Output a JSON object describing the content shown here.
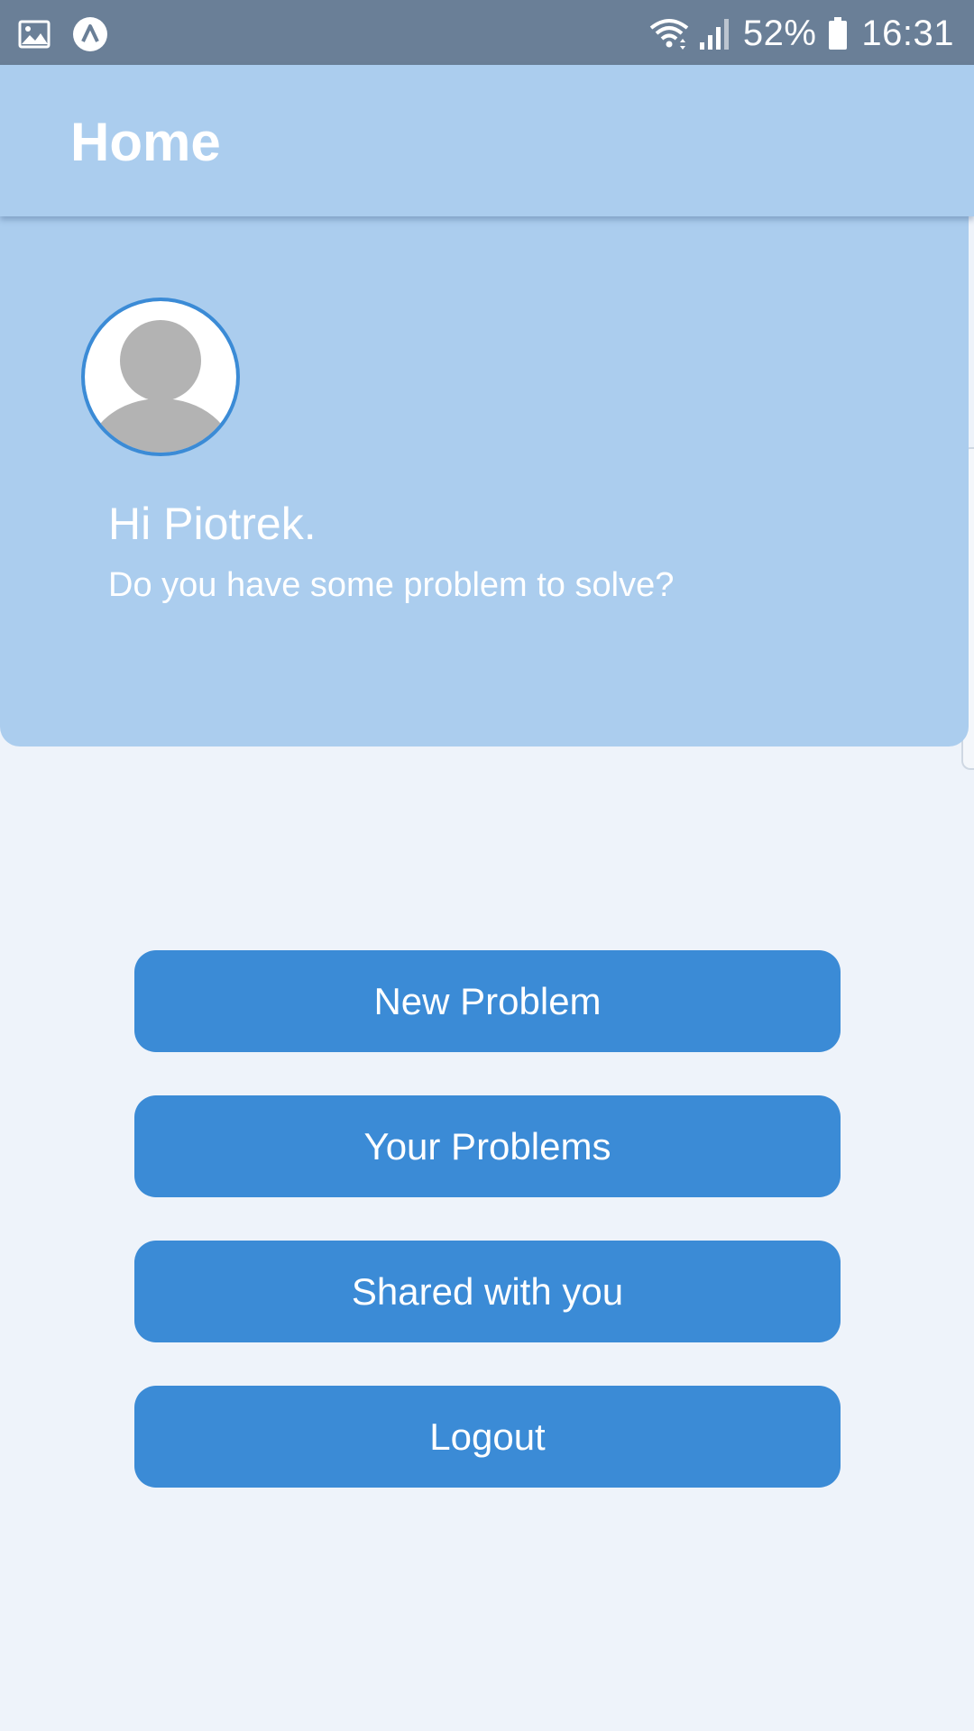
{
  "status_bar": {
    "left_icons": [
      "gallery-icon",
      "app-notification-icon"
    ],
    "right_icons": [
      "wifi-icon",
      "signal-icon",
      "battery-icon"
    ],
    "battery_percent": "52%",
    "time": "16:31"
  },
  "app_bar": {
    "title": "Home"
  },
  "profile": {
    "avatar_icon": "avatar-placeholder-icon",
    "greeting": "Hi Piotrek.",
    "subtitle": "Do you have some problem to solve?"
  },
  "actions": {
    "new_problem": "New Problem",
    "your_problems": "Your Problems",
    "shared_with_you": "Shared with you",
    "logout": "Logout"
  },
  "colors": {
    "status_bar": "#6a7f97",
    "app_bar": "#abcdee",
    "background": "#eef3fa",
    "button": "#3b8bd6",
    "avatar_ring": "#3b8bd6",
    "avatar_figure": "#b3b3b3"
  }
}
